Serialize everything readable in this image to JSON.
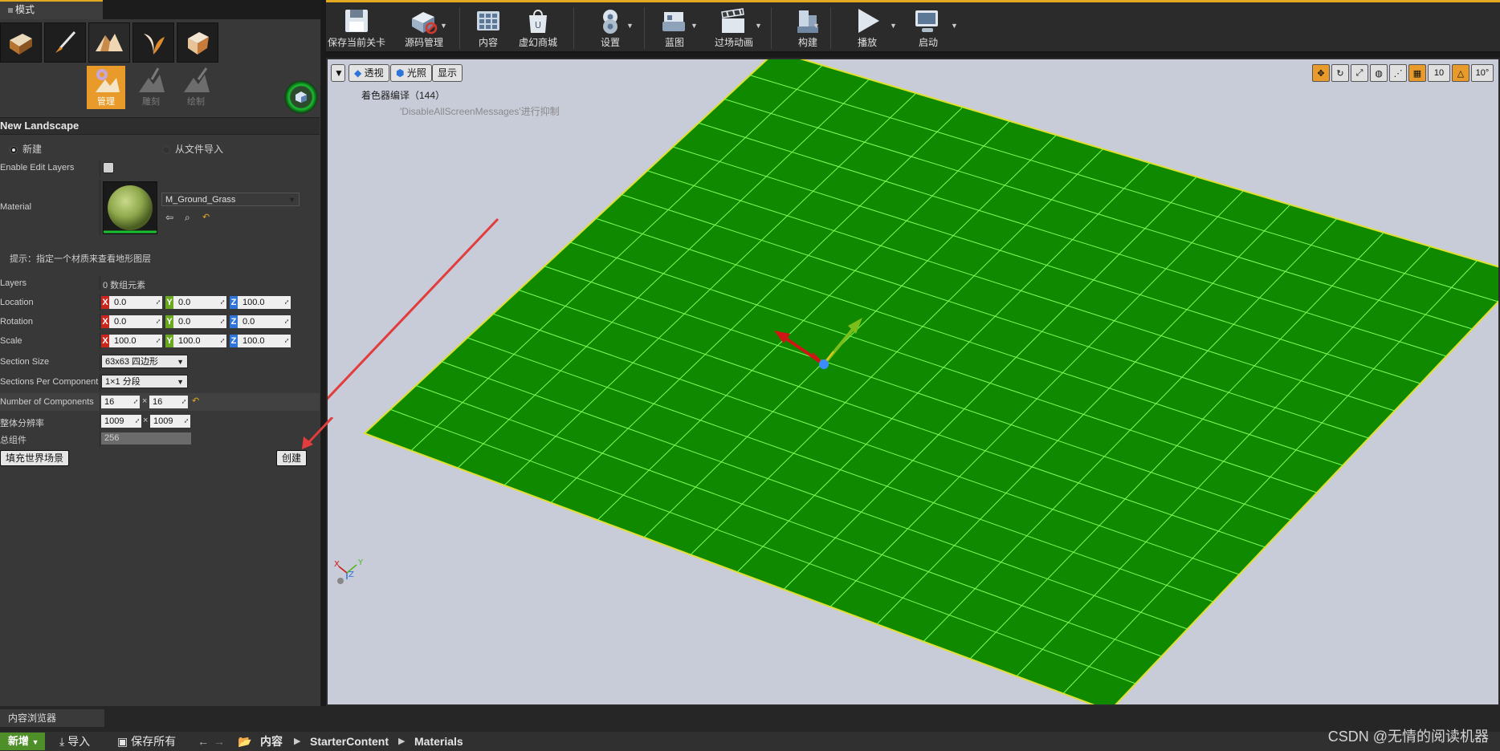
{
  "modes_panel": {
    "tab_title": "模式",
    "mode_icons": [
      "place-mode-icon",
      "paint-mode-icon",
      "landscape-mode-icon",
      "foliage-mode-icon",
      "geometry-mode-icon"
    ],
    "tools": [
      {
        "label": "管理",
        "active": true
      },
      {
        "label": "雕刻",
        "active": false
      },
      {
        "label": "绘制",
        "active": false
      }
    ],
    "section_title": "New Landscape",
    "source_options": {
      "new": "新建",
      "import": "从文件导入"
    },
    "enable_edit_layers": {
      "label": "Enable Edit Layers",
      "checked": false
    },
    "material": {
      "label": "Material",
      "value": "M_Ground_Grass"
    },
    "hint": "提示：指定一个材质来查看地形图层",
    "layers": {
      "label": "Layers",
      "value": "0 数组元素"
    },
    "location": {
      "label": "Location",
      "x": "0.0",
      "y": "0.0",
      "z": "100.0"
    },
    "rotation": {
      "label": "Rotation",
      "x": "0.0",
      "y": "0.0",
      "z": "0.0"
    },
    "scale": {
      "label": "Scale",
      "x": "100.0",
      "y": "100.0",
      "z": "100.0"
    },
    "section_size": {
      "label": "Section Size",
      "value": "63x63 四边形"
    },
    "sections_per_component": {
      "label": "Sections Per Component",
      "value": "1×1 分段"
    },
    "number_of_components": {
      "label": "Number of Components",
      "x": "16",
      "y": "16",
      "sep": "×"
    },
    "overall_resolution": {
      "label": "整体分辨率",
      "x": "1009",
      "y": "1009",
      "sep": "×"
    },
    "total_components": {
      "label": "总组件",
      "value": "256"
    },
    "fill_world_button": "填充世界场景",
    "create_button": "创建"
  },
  "toolbar": {
    "buttons": [
      {
        "label": "保存当前关卡",
        "icon": "save-icon"
      },
      {
        "label": "源码管理",
        "icon": "source-control-icon"
      },
      {
        "label": "内容",
        "icon": "content-icon"
      },
      {
        "label": "虚幻商城",
        "icon": "marketplace-icon"
      },
      {
        "label": "设置",
        "icon": "settings-icon"
      },
      {
        "label": "蓝图",
        "icon": "blueprint-icon"
      },
      {
        "label": "过场动画",
        "icon": "cinematics-icon"
      },
      {
        "label": "构建",
        "icon": "build-icon"
      },
      {
        "label": "播放",
        "icon": "play-icon"
      },
      {
        "label": "启动",
        "icon": "launch-icon"
      }
    ]
  },
  "viewport": {
    "perspective": "透视",
    "lit": "光照",
    "show": "显示",
    "shader_msg": "着色器编译（144）",
    "suppress_msg": "'DisableAllScreenMessages'进行抑制",
    "grid_snap": "10",
    "rotation_snap": "10°",
    "background_color": "#c8cbd8",
    "landscape_color": "#0f8a00",
    "grid_color": "#7dff58"
  },
  "content_browser": {
    "tab": "内容浏览器",
    "new": "新增",
    "import": "导入",
    "save_all": "保存所有",
    "breadcrumbs": [
      "内容",
      "StarterContent",
      "Materials"
    ]
  },
  "watermark": "CSDN @无情的阅读机器"
}
